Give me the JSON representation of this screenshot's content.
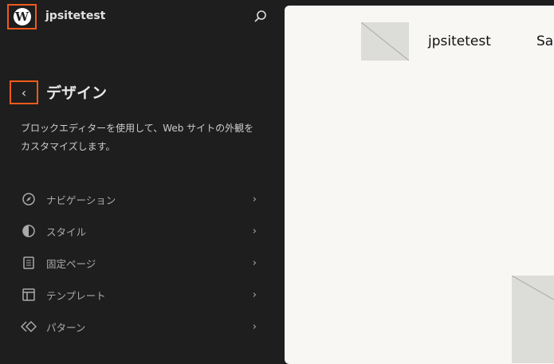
{
  "header": {
    "site_name": "jpsitetest",
    "logo": "W"
  },
  "panel": {
    "title": "デザイン",
    "description": "ブロックエディターを使用して、Web サイトの外観をカスタマイズします。"
  },
  "menu": [
    {
      "label": "ナビゲーション",
      "icon": "navigation-icon"
    },
    {
      "label": "スタイル",
      "icon": "styles-icon"
    },
    {
      "label": "固定ページ",
      "icon": "page-icon"
    },
    {
      "label": "テンプレート",
      "icon": "template-icon"
    },
    {
      "label": "パターン",
      "icon": "pattern-icon"
    }
  ],
  "preview": {
    "site_name": "jpsitetest",
    "nav_partial": "Sar"
  }
}
